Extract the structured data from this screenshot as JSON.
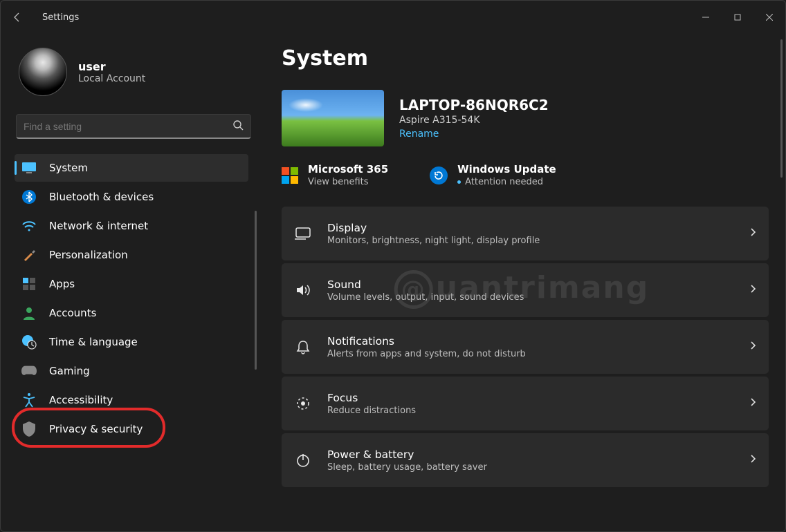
{
  "app_title": "Settings",
  "user": {
    "name": "user",
    "account_type": "Local Account"
  },
  "search": {
    "placeholder": "Find a setting"
  },
  "sidebar": {
    "items": [
      {
        "id": "system",
        "label": "System"
      },
      {
        "id": "bluetooth",
        "label": "Bluetooth & devices"
      },
      {
        "id": "network",
        "label": "Network & internet"
      },
      {
        "id": "personalization",
        "label": "Personalization"
      },
      {
        "id": "apps",
        "label": "Apps"
      },
      {
        "id": "accounts",
        "label": "Accounts"
      },
      {
        "id": "time",
        "label": "Time & language"
      },
      {
        "id": "gaming",
        "label": "Gaming"
      },
      {
        "id": "accessibility",
        "label": "Accessibility"
      },
      {
        "id": "privacy",
        "label": "Privacy & security"
      }
    ]
  },
  "page": {
    "title": "System",
    "device": {
      "name": "LAPTOP-86NQR6C2",
      "model": "Aspire A315-54K",
      "rename": "Rename"
    },
    "ms365": {
      "title": "Microsoft 365",
      "sub": "View benefits"
    },
    "wupdate": {
      "title": "Windows Update",
      "sub": "Attention needed"
    },
    "cards": [
      {
        "id": "display",
        "title": "Display",
        "sub": "Monitors, brightness, night light, display profile"
      },
      {
        "id": "sound",
        "title": "Sound",
        "sub": "Volume levels, output, input, sound devices"
      },
      {
        "id": "notifications",
        "title": "Notifications",
        "sub": "Alerts from apps and system, do not disturb"
      },
      {
        "id": "focus",
        "title": "Focus",
        "sub": "Reduce distractions"
      },
      {
        "id": "power",
        "title": "Power & battery",
        "sub": "Sleep, battery usage, battery saver"
      }
    ]
  },
  "watermark": "uantrimang"
}
